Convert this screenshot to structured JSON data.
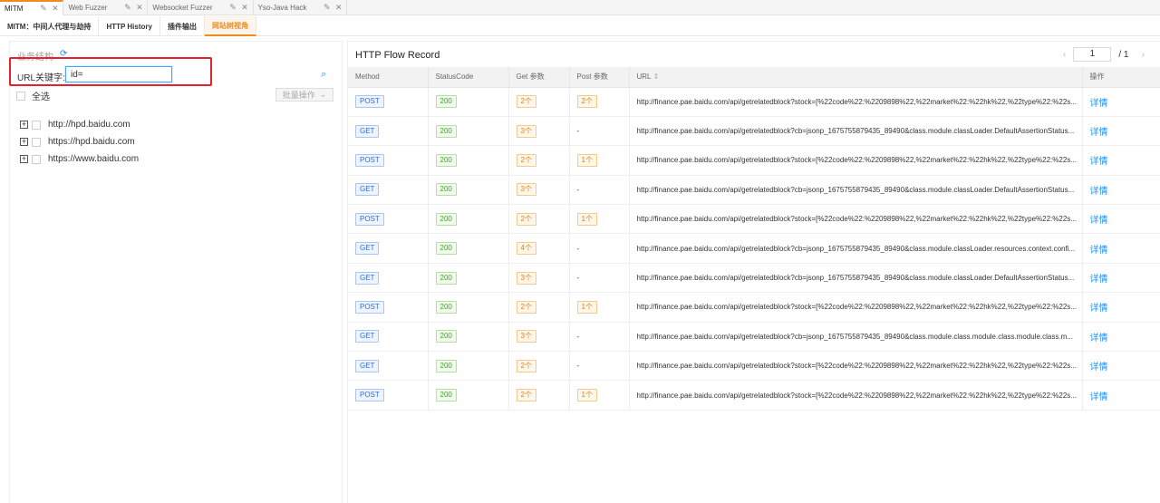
{
  "top_tabs": [
    "MITM",
    "Web Fuzzer",
    "Websocket Fuzzer",
    "Yso-Java Hack"
  ],
  "sub_tabs": [
    "MITM：中间人代理与劫持",
    "HTTP History",
    "插件输出",
    "网站树视角"
  ],
  "left": {
    "title": "业务结构",
    "keyword_label": "URL关键字:",
    "keyword_value": "id=",
    "select_all": "全选",
    "batch_button": "批量操作",
    "tree": [
      "http://hpd.baidu.com",
      "https://hpd.baidu.com",
      "https://www.baidu.com"
    ]
  },
  "right": {
    "title": "HTTP Flow Record",
    "pager": {
      "current": "1",
      "total": "/ 1"
    },
    "columns": [
      "Method",
      "StatusCode",
      "Get 参数",
      "Post 参数",
      "URL",
      "操作"
    ],
    "detail_label": "详情",
    "rows": [
      {
        "method": "POST",
        "status": "200",
        "get": "2个",
        "post": "2个",
        "url": "http://finance.pae.baidu.com/api/getrelatedblock?stock=[%22code%22:%2209898%22,%22market%22:%22hk%22,%22type%22:%22s..."
      },
      {
        "method": "GET",
        "status": "200",
        "get": "3个",
        "post": "-",
        "url": "http://finance.pae.baidu.com/api/getrelatedblock?cb=jsonp_1675755879435_89490&class.module.classLoader.DefaultAssertionStatus..."
      },
      {
        "method": "POST",
        "status": "200",
        "get": "2个",
        "post": "1个",
        "url": "http://finance.pae.baidu.com/api/getrelatedblock?stock=[%22code%22:%2209898%22,%22market%22:%22hk%22,%22type%22:%22s..."
      },
      {
        "method": "GET",
        "status": "200",
        "get": "3个",
        "post": "-",
        "url": "http://finance.pae.baidu.com/api/getrelatedblock?cb=jsonp_1675755879435_89490&class.module.classLoader.DefaultAssertionStatus..."
      },
      {
        "method": "POST",
        "status": "200",
        "get": "2个",
        "post": "1个",
        "url": "http://finance.pae.baidu.com/api/getrelatedblock?stock=[%22code%22:%2209898%22,%22market%22:%22hk%22,%22type%22:%22s..."
      },
      {
        "method": "GET",
        "status": "200",
        "get": "4个",
        "post": "-",
        "url": "http://finance.pae.baidu.com/api/getrelatedblock?cb=jsonp_1675755879435_89490&class.module.classLoader.resources.context.confi..."
      },
      {
        "method": "GET",
        "status": "200",
        "get": "3个",
        "post": "-",
        "url": "http://finance.pae.baidu.com/api/getrelatedblock?cb=jsonp_1675755879435_89490&class.module.classLoader.DefaultAssertionStatus..."
      },
      {
        "method": "POST",
        "status": "200",
        "get": "2个",
        "post": "1个",
        "url": "http://finance.pae.baidu.com/api/getrelatedblock?stock=[%22code%22:%2209898%22,%22market%22:%22hk%22,%22type%22:%22s..."
      },
      {
        "method": "GET",
        "status": "200",
        "get": "3个",
        "post": "-",
        "url": "http://finance.pae.baidu.com/api/getrelatedblock?cb=jsonp_1675755879435_89490&class.module.class.module.class.module.class.m..."
      },
      {
        "method": "GET",
        "status": "200",
        "get": "2个",
        "post": "-",
        "url": "http://finance.pae.baidu.com/api/getrelatedblock?stock=[%22code%22:%2209898%22,%22market%22:%22hk%22,%22type%22:%22s..."
      },
      {
        "method": "POST",
        "status": "200",
        "get": "2个",
        "post": "1个",
        "url": "http://finance.pae.baidu.com/api/getrelatedblock?stock=[%22code%22:%2209898%22,%22market%22:%22hk%22,%22type%22:%22s..."
      }
    ]
  },
  "colors": {
    "accent": "#f08c1c",
    "link": "#1890ff",
    "highlight_box": "#e5222b"
  }
}
